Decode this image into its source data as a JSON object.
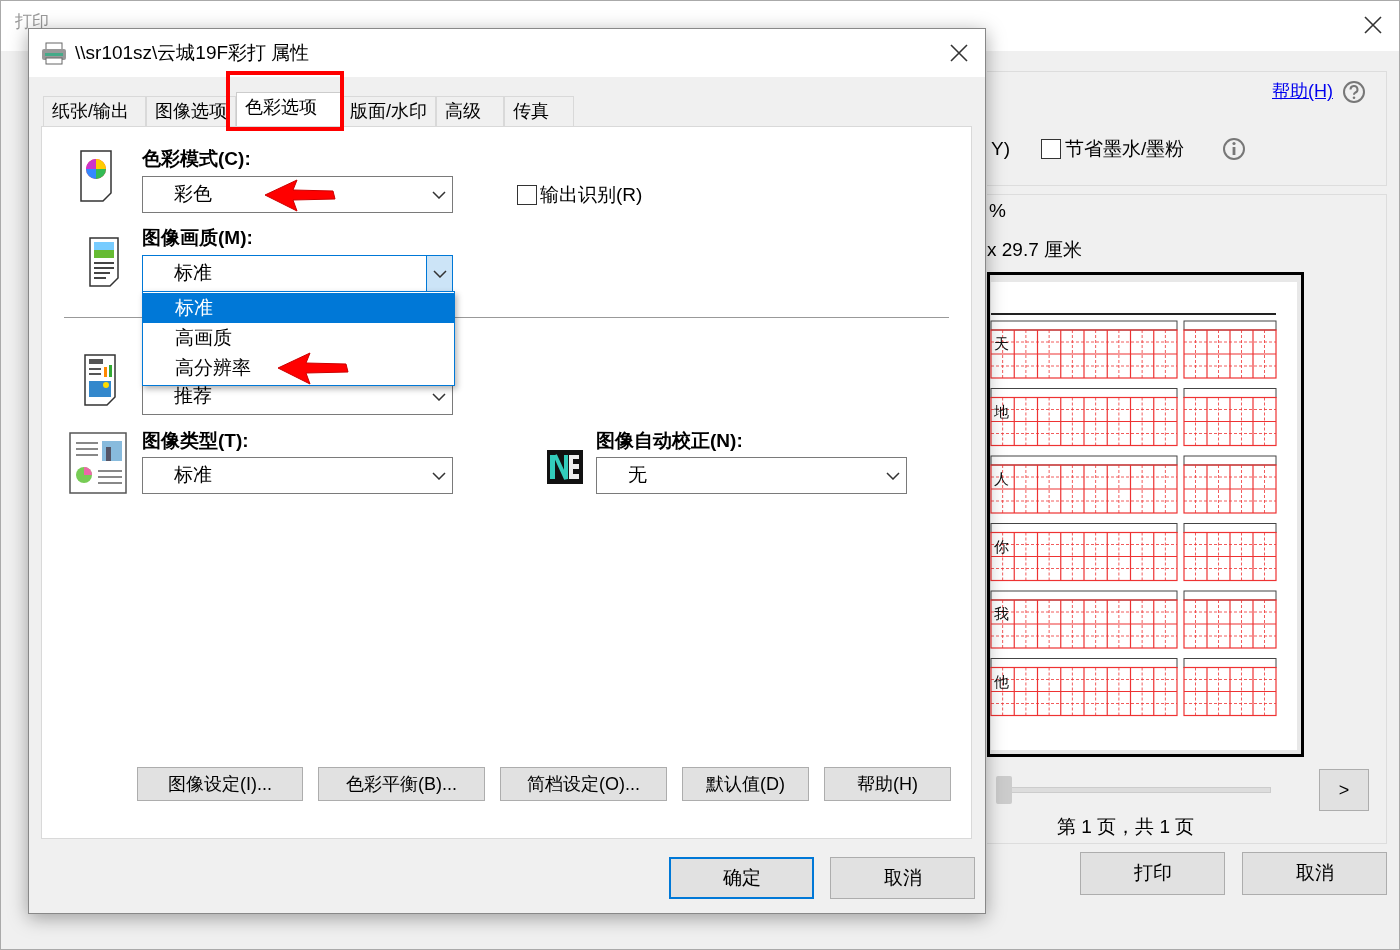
{
  "background_window": {
    "title": "打印",
    "help_link": "帮助(H)",
    "option_fragment": "Y)",
    "save_toner": {
      "label": "节省墨水/墨粉",
      "checked": false
    },
    "scale_fragment": "%",
    "paper_size": "x 29.7 厘米",
    "preview": {
      "kind": "practice-sheet",
      "characters": [
        "天",
        "地",
        "人",
        "你",
        "我",
        "他"
      ]
    },
    "page_slider": {
      "level": 0
    },
    "next_button": ">",
    "page_label": "第 1 页，共 1 页",
    "buttons": [
      "打印",
      "取消"
    ]
  },
  "dialog": {
    "title": "\\\\sr101sz\\云城19F彩打 属性",
    "tabs": [
      {
        "label": "纸张/输出",
        "selected": false,
        "marked": false
      },
      {
        "label": "图像选项",
        "selected": false,
        "marked": false
      },
      {
        "label": "色彩选项",
        "selected": true,
        "marked": true
      },
      {
        "label": "版面/水印",
        "selected": false,
        "marked": false
      },
      {
        "label": "高级",
        "selected": false,
        "marked": false
      },
      {
        "label": "传真",
        "selected": false,
        "marked": false
      }
    ],
    "color_mode": {
      "label": "色彩模式(C):",
      "value": "彩色",
      "marked": true
    },
    "output_id": {
      "label": "输出识别(R)",
      "checked": false
    },
    "image_quality": {
      "label": "图像画质(M):",
      "value": "标准",
      "expanded": true,
      "options": [
        {
          "label": "标准",
          "selected": true,
          "marked": false
        },
        {
          "label": "高画质",
          "selected": false,
          "marked": false
        },
        {
          "label": "高分辨率",
          "selected": false,
          "marked": true
        }
      ]
    },
    "covered_field": {
      "value": "推荐"
    },
    "image_type": {
      "label": "图像类型(T):",
      "value": "标准"
    },
    "auto_correction": {
      "label": "图像自动校正(N):",
      "value": "无"
    },
    "buttons": [
      "图像设定(I)...",
      "色彩平衡(B)...",
      "简档设定(O)...",
      "默认值(D)",
      "帮助(H)"
    ],
    "footer_buttons": [
      {
        "label": "确定",
        "default": true
      },
      {
        "label": "取消",
        "default": false
      }
    ]
  }
}
